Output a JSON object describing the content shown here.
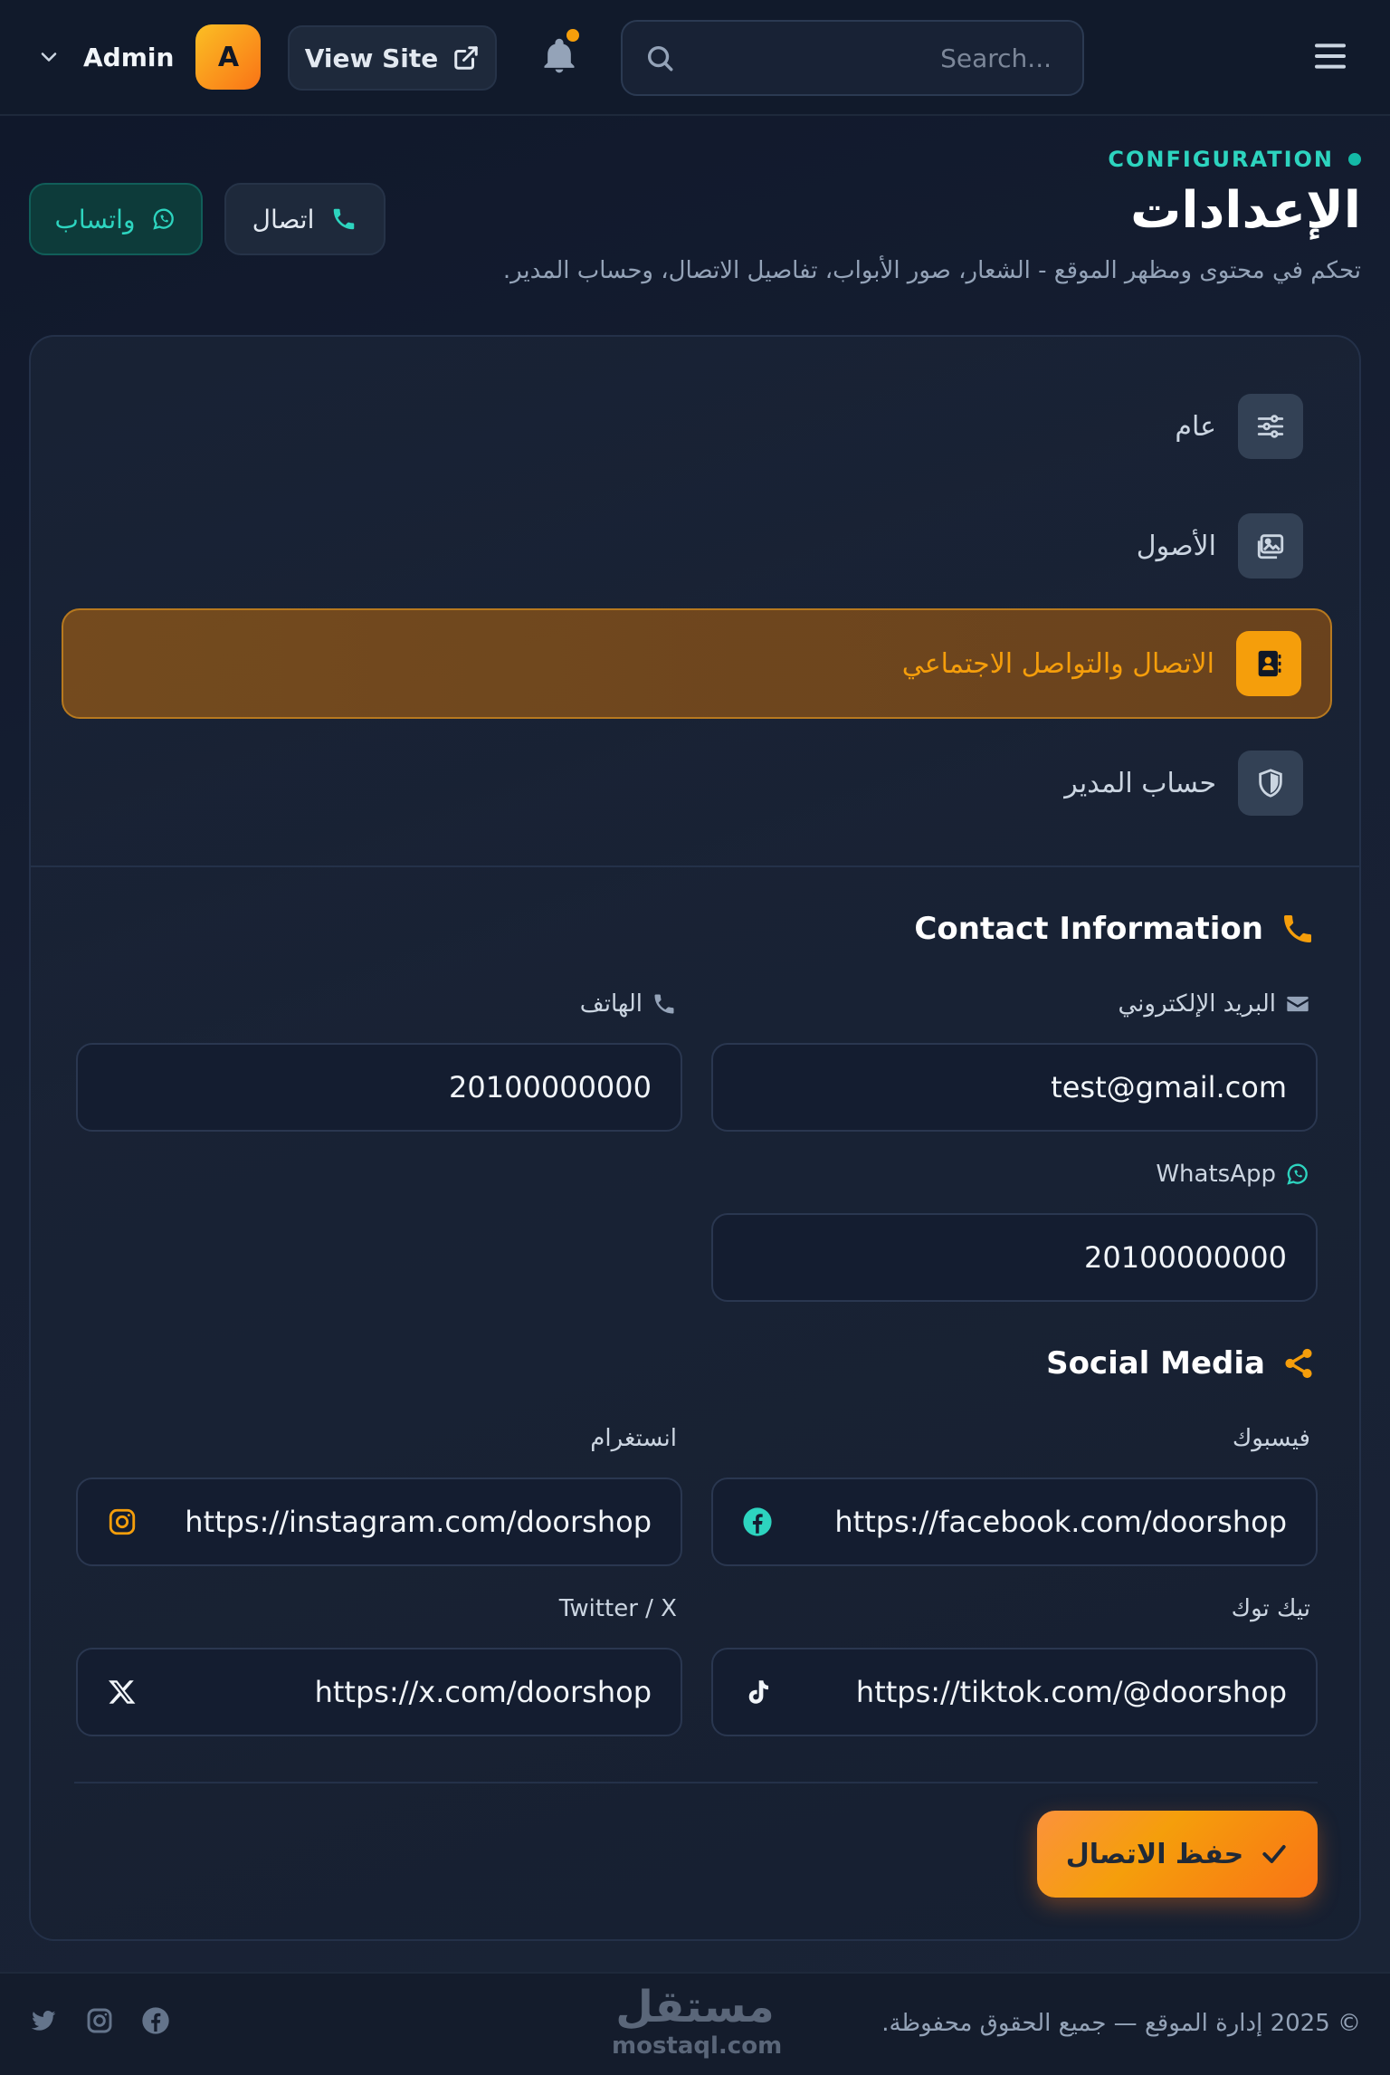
{
  "header": {
    "user_name": "Admin",
    "avatar_letter": "A",
    "view_site_label": "View Site",
    "search_placeholder": "Search..."
  },
  "page": {
    "eyebrow": "CONFIGURATION",
    "title": "الإعدادات",
    "subtitle": "تحكم في محتوى ومظهر الموقع - الشعار، صور الأبواب، تفاصيل الاتصال، وحساب المدير.",
    "call_button": "اتصال",
    "whatsapp_button": "واتساب"
  },
  "tabs": [
    {
      "label": "عام",
      "icon": "sliders-icon",
      "active": false
    },
    {
      "label": "الأصول",
      "icon": "images-icon",
      "active": false
    },
    {
      "label": "الاتصال والتواصل الاجتماعي",
      "icon": "address-book-icon",
      "active": true
    },
    {
      "label": "حساب المدير",
      "icon": "shield-icon",
      "active": false
    }
  ],
  "contact": {
    "heading": "Contact Information",
    "email_label": "البريد الإلكتروني",
    "email_value": "test@gmail.com",
    "phone_label": "الهاتف",
    "phone_value": "20100000000",
    "whatsapp_label": "WhatsApp",
    "whatsapp_value": "20100000000"
  },
  "social": {
    "heading": "Social Media",
    "facebook_label": "فيسبوك",
    "facebook_value": "https://facebook.com/doorshop",
    "instagram_label": "انستغرام",
    "instagram_value": "https://instagram.com/doorshop",
    "tiktok_label": "تيك توك",
    "tiktok_value": "https://tiktok.com/@doorshop",
    "twitter_label": "Twitter / X",
    "twitter_value": "https://x.com/doorshop"
  },
  "save_label": "حفظ الاتصال",
  "footer": {
    "copyright": "© 2025 إدارة الموقع — جميع الحقوق محفوظة.",
    "brand_ar": "مستقل",
    "brand_en": "mostaql.com"
  },
  "colors": {
    "accent": "#f59e0b",
    "teal": "#2dd4bf",
    "background": "#0f172a"
  }
}
